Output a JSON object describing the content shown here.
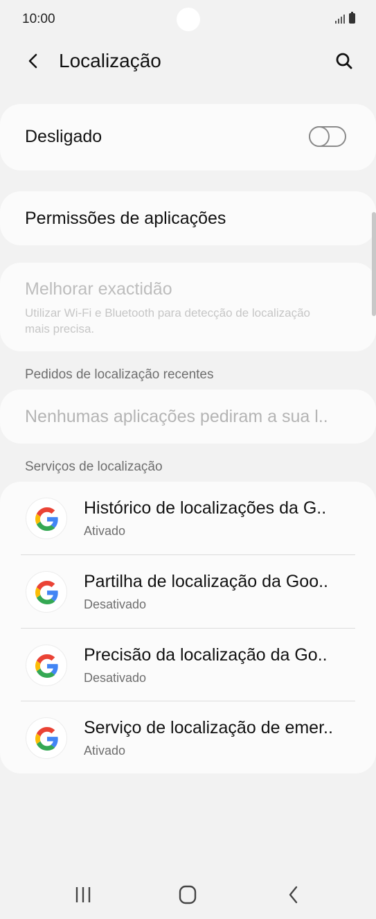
{
  "status_bar": {
    "time": "10:00"
  },
  "app_bar": {
    "title": "Localização"
  },
  "master_toggle": {
    "label": "Desligado",
    "state": "off"
  },
  "permissions": {
    "label": "Permissões de aplicações"
  },
  "accuracy": {
    "title": "Melhorar exactidão",
    "subtitle": "Utilizar Wi-Fi e Bluetooth para detecção de localização mais precisa."
  },
  "recent_requests": {
    "header": "Pedidos de localização recentes",
    "empty_text": "Nenhumas aplicações pediram a sua l.."
  },
  "location_services": {
    "header": "Serviços de localização",
    "items": [
      {
        "title": "Histórico de localizações da G..",
        "status": "Ativado",
        "icon": "google-g-icon"
      },
      {
        "title": "Partilha de localização da Goo..",
        "status": "Desativado",
        "icon": "google-g-icon"
      },
      {
        "title": "Precisão da localização da Go..",
        "status": "Desativado",
        "icon": "google-g-icon"
      },
      {
        "title": "Serviço de localização de emer..",
        "status": "Ativado",
        "icon": "google-g-icon"
      }
    ]
  },
  "colors": {
    "background": "#f2f2f2",
    "card": "#fbfbfb",
    "google_blue": "#4285F4",
    "google_red": "#EA4335",
    "google_yellow": "#FBBC05",
    "google_green": "#34A853"
  }
}
